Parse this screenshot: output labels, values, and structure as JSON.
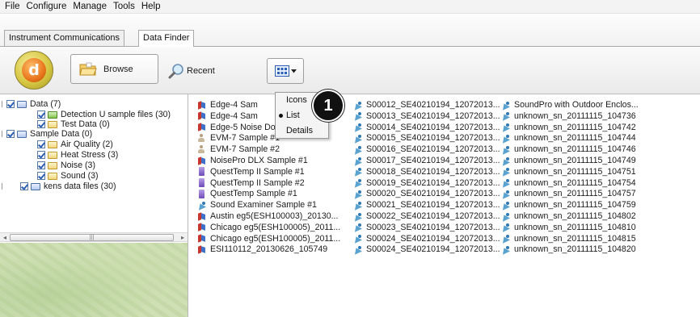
{
  "menubar": {
    "items": [
      "File",
      "Configure",
      "Manage",
      "Tools",
      "Help"
    ]
  },
  "tabs": [
    {
      "label": "Instrument Communications",
      "active": false
    },
    {
      "label": "Data Finder",
      "active": true
    }
  ],
  "toolbar": {
    "logo_letter": "d",
    "browse_label": "Browse",
    "recent_label": "Recent"
  },
  "view_menu": {
    "items": [
      {
        "label": "Icons",
        "selected": false
      },
      {
        "label": "List",
        "selected": true
      },
      {
        "label": "Details",
        "selected": false
      }
    ]
  },
  "callout_number": "1",
  "tree": [
    {
      "label": "Data (7)",
      "icon": "database-icon"
    },
    {
      "label": "Detection U sample files (30)",
      "icon": "check-folder-icon"
    },
    {
      "label": "Test Data (0)",
      "icon": "folder-icon"
    },
    {
      "label": "Sample Data (0)",
      "icon": "database-icon"
    },
    {
      "label": "Air Quality (2)",
      "icon": "folder-icon"
    },
    {
      "label": "Heat Stress (3)",
      "icon": "folder-icon"
    },
    {
      "label": "Noise (3)",
      "icon": "folder-icon"
    },
    {
      "label": "Sound (3)",
      "icon": "folder-icon"
    },
    {
      "label": "kens data files (30)",
      "icon": "database-icon"
    }
  ],
  "files": {
    "col1": [
      {
        "label": "Edge-4 Sam",
        "icon": "flag"
      },
      {
        "label": "Edge-4 Sam",
        "icon": "flag"
      },
      {
        "label": "Edge-5 Noise Dosimeter Sa...",
        "icon": "flag"
      },
      {
        "label": "EVM-7 Sample #1",
        "icon": "person"
      },
      {
        "label": "EVM-7 Sample #2",
        "icon": "person"
      },
      {
        "label": "NoisePro DLX Sample #1",
        "icon": "flag"
      },
      {
        "label": "QuestTemp II Sample #1",
        "icon": "qt"
      },
      {
        "label": "QuestTemp II Sample #2",
        "icon": "qt"
      },
      {
        "label": "QuestTemp Sample #1",
        "icon": "qt"
      },
      {
        "label": "Sound Examiner Sample #1",
        "icon": "wedge"
      },
      {
        "label": "Austin eg5(ESH100003)_20130...",
        "icon": "flag"
      },
      {
        "label": "Chicago eg5(ESH100005)_2011...",
        "icon": "flag"
      },
      {
        "label": "Chicago eg5(ESH100005)_2011...",
        "icon": "flag"
      },
      {
        "label": "ESI110112_20130626_105749",
        "icon": "flag"
      }
    ],
    "col2": [
      "S00012_SE40210194_12072013...",
      "S00013_SE40210194_12072013...",
      "S00014_SE40210194_12072013...",
      "S00015_SE40210194_12072013...",
      "S00016_SE40210194_12072013...",
      "S00017_SE40210194_12072013...",
      "S00018_SE40210194_12072013...",
      "S00019_SE40210194_12072013...",
      "S00020_SE40210194_12072013...",
      "S00021_SE40210194_12072013...",
      "S00022_SE40210194_12072013...",
      "S00023_SE40210194_12072013...",
      "S00024_SE40210194_12072013...",
      "S00024_SE40210194_12072013..."
    ],
    "col3": [
      "SoundPro with Outdoor Enclos...",
      "unknown_sn_20111115_104736",
      "unknown_sn_20111115_104742",
      "unknown_sn_20111115_104744",
      "unknown_sn_20111115_104746",
      "unknown_sn_20111115_104749",
      "unknown_sn_20111115_104751",
      "unknown_sn_20111115_104754",
      "unknown_sn_20111115_104757",
      "unknown_sn_20111115_104759",
      "unknown_sn_20111115_104802",
      "unknown_sn_20111115_104810",
      "unknown_sn_20111115_104815",
      "unknown_sn_20111115_104820"
    ]
  },
  "colors": {
    "accent": "#2d5fb5",
    "logo_outer": "#d6c743",
    "logo_inner": "#e9761c"
  }
}
